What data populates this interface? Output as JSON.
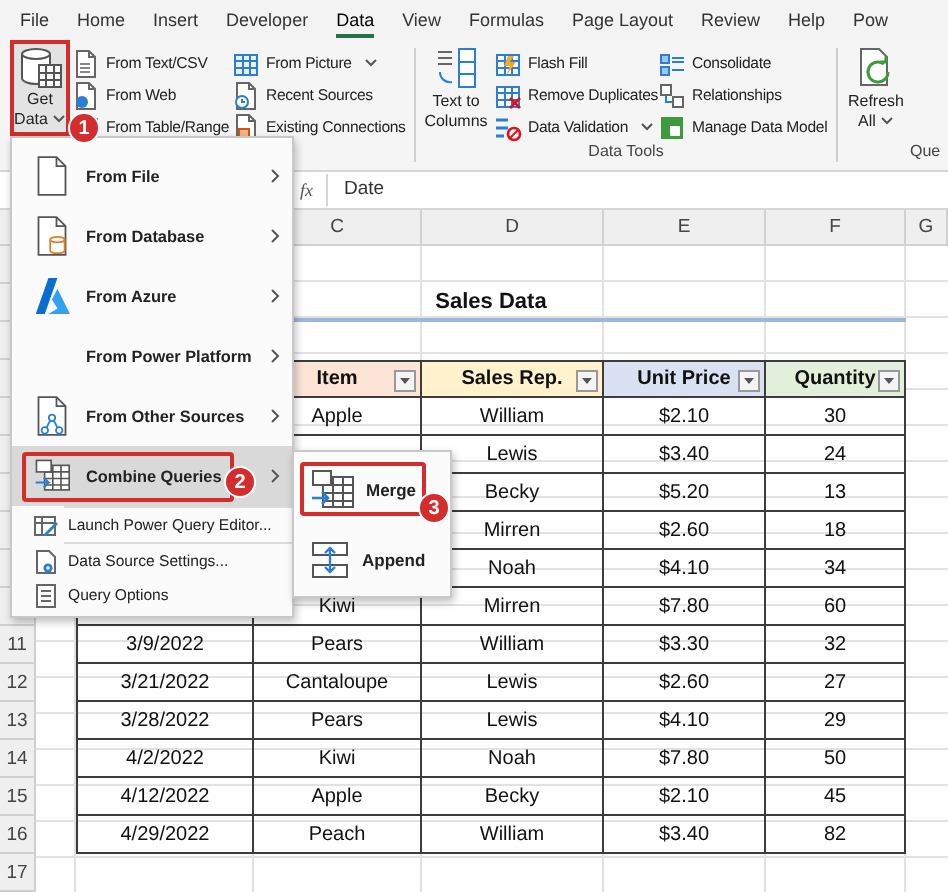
{
  "tabs": [
    {
      "label": "File",
      "selected": false
    },
    {
      "label": "Home",
      "selected": false
    },
    {
      "label": "Insert",
      "selected": false
    },
    {
      "label": "Developer",
      "selected": false
    },
    {
      "label": "Data",
      "selected": true
    },
    {
      "label": "View",
      "selected": false
    },
    {
      "label": "Formulas",
      "selected": false
    },
    {
      "label": "Page Layout",
      "selected": false
    },
    {
      "label": "Review",
      "selected": false
    },
    {
      "label": "Help",
      "selected": false
    },
    {
      "label": "Pow",
      "selected": false
    }
  ],
  "ribbon": {
    "get_data": {
      "label": "Get Data",
      "dropdown": true,
      "highlighted": true,
      "callout": "1"
    },
    "import_columns": [
      [
        {
          "label": "From Text/CSV"
        },
        {
          "label": "From Web"
        },
        {
          "label": "From Table/Range"
        }
      ],
      [
        {
          "label": "From Picture",
          "dropdown": true
        },
        {
          "label": "Recent Sources"
        },
        {
          "label": "Existing Connections"
        }
      ]
    ],
    "text_to_columns": {
      "label": "Text to Columns"
    },
    "data_tools": {
      "columns": [
        [
          {
            "label": "Flash Fill"
          },
          {
            "label": "Remove Duplicates"
          },
          {
            "label": "Data Validation",
            "dropdown": true
          }
        ],
        [
          {
            "label": "Consolidate"
          },
          {
            "label": "Relationships"
          },
          {
            "label": "Manage Data Model"
          }
        ]
      ],
      "group_label": "Data Tools"
    },
    "refresh_all": {
      "label": "Refresh All",
      "dropdown": true
    },
    "queries_group_label": "Que"
  },
  "formula_bar": {
    "function_label": "fx",
    "value": "Date"
  },
  "sheet": {
    "columns": [
      "C",
      "D",
      "E",
      "F",
      "G"
    ],
    "title": "Sales Data",
    "headers": [
      {
        "label": "Item",
        "color": "#fce4d6"
      },
      {
        "label": "Sales Rep.",
        "color": "#fff2cc"
      },
      {
        "label": "Unit Price",
        "color": "#d9e1f2"
      },
      {
        "label": "Quantity",
        "color": "#e2efda"
      }
    ],
    "rows": [
      {
        "item": "Apple",
        "sales_rep": "William",
        "unit_price": "$2.10",
        "quantity": "30"
      },
      {
        "sales_rep": "Lewis",
        "unit_price": "$3.40",
        "quantity": "24"
      },
      {
        "sales_rep": "Becky",
        "unit_price": "$5.20",
        "quantity": "13"
      },
      {
        "sales_rep": "Mirren",
        "unit_price": "$2.60",
        "quantity": "18"
      },
      {
        "sales_rep": "Noah",
        "unit_price": "$4.10",
        "quantity": "34"
      },
      {
        "item": "Kiwi",
        "sales_rep": "Mirren",
        "unit_price": "$7.80",
        "quantity": "60"
      },
      {
        "row_number": "11",
        "date": "3/9/2022",
        "item": "Pears",
        "sales_rep": "William",
        "unit_price": "$3.30",
        "quantity": "32"
      },
      {
        "row_number": "12",
        "date": "3/21/2022",
        "item": "Cantaloupe",
        "sales_rep": "Lewis",
        "unit_price": "$2.60",
        "quantity": "27"
      },
      {
        "row_number": "13",
        "date": "3/28/2022",
        "item": "Pears",
        "sales_rep": "Lewis",
        "unit_price": "$4.10",
        "quantity": "29"
      },
      {
        "row_number": "14",
        "date": "4/2/2022",
        "item": "Kiwi",
        "sales_rep": "Noah",
        "unit_price": "$7.80",
        "quantity": "50"
      },
      {
        "row_number": "15",
        "date": "4/12/2022",
        "item": "Apple",
        "sales_rep": "Becky",
        "unit_price": "$2.10",
        "quantity": "45"
      },
      {
        "row_number": "16",
        "date": "4/29/2022",
        "item": "Peach",
        "sales_rep": "William",
        "unit_price": "$3.40",
        "quantity": "82"
      }
    ],
    "trailing_rows": [
      "17"
    ]
  },
  "menu": {
    "items": [
      {
        "kind": "source",
        "label": "From File",
        "submenu": true,
        "selected": false
      },
      {
        "kind": "source",
        "label": "From Database",
        "submenu": true,
        "selected": false
      },
      {
        "kind": "source",
        "label": "From Azure",
        "submenu": true,
        "selected": false
      },
      {
        "kind": "source",
        "label": "From Power Platform",
        "submenu": true,
        "selected": false
      },
      {
        "kind": "source",
        "label": "From Other Sources",
        "submenu": true,
        "selected": false
      },
      {
        "kind": "source",
        "label": "Combine Queries",
        "submenu": true,
        "selected": true,
        "highlighted": true,
        "callout": "2"
      },
      {
        "kind": "separator"
      },
      {
        "kind": "command",
        "label": "Launch Power Query Editor...",
        "selected": false
      },
      {
        "kind": "separator"
      },
      {
        "kind": "command",
        "label": "Data Source Settings...",
        "selected": false
      },
      {
        "kind": "command",
        "label": "Query Options",
        "selected": false
      }
    ]
  },
  "submenu": {
    "items": [
      {
        "label": "Merge",
        "selected": false,
        "highlighted": true,
        "callout": "3"
      },
      {
        "label": "Append",
        "selected": false
      }
    ]
  }
}
